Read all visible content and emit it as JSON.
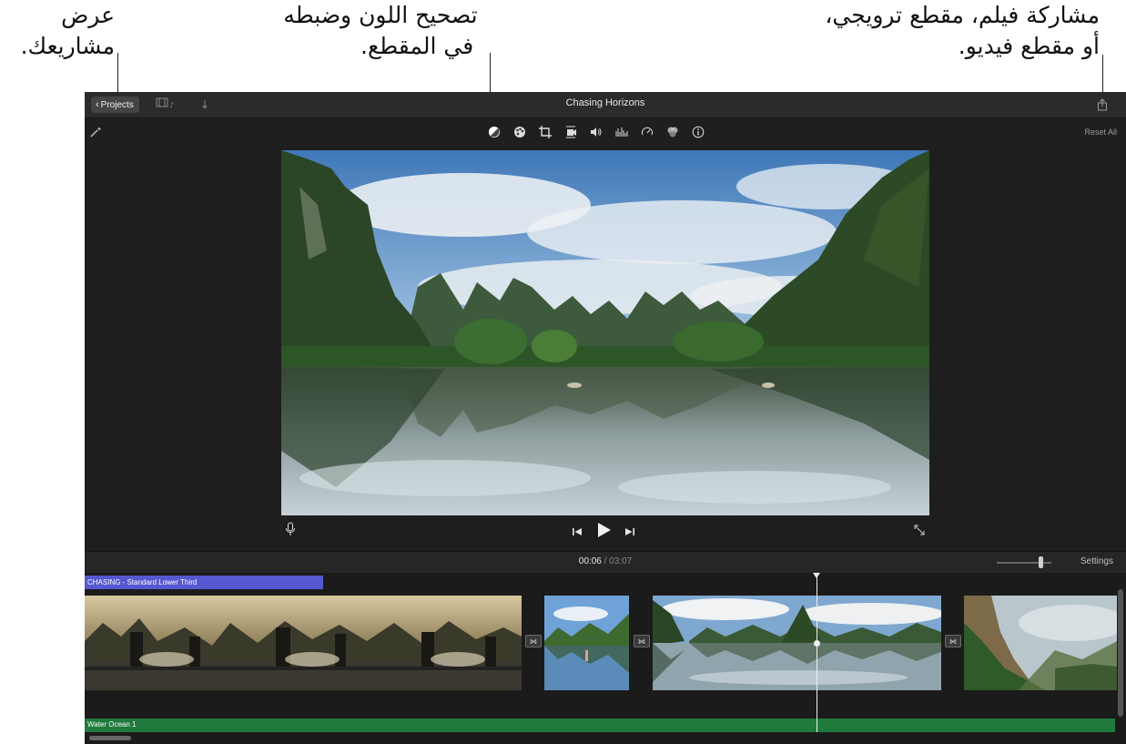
{
  "callouts": {
    "projects_line1": "عرض",
    "projects_line2": "مشاريعك.",
    "color_line1": "تصحيح اللون وضبطه",
    "color_line2": "في المقطع.",
    "share_line1": "مشاركة فيلم، مقطع ترويجي،",
    "share_line2": "أو مقطع فيديو."
  },
  "titlebar": {
    "projects_label": "Projects",
    "window_title": "Chasing Horizons"
  },
  "toolbar": {
    "reset_label": "Reset All",
    "tools": [
      "color-balance",
      "color-correction",
      "cropping",
      "stabilization",
      "volume",
      "noise-reduction-eq",
      "speed",
      "clip-filter",
      "clip-info"
    ]
  },
  "timeline": {
    "current_time": "00:06",
    "separator": "/",
    "total_time": "03:07",
    "settings_label": "Settings",
    "title_clip": "CHASING - Standard Lower Third",
    "audio_clip": "Water Ocean 1"
  }
}
